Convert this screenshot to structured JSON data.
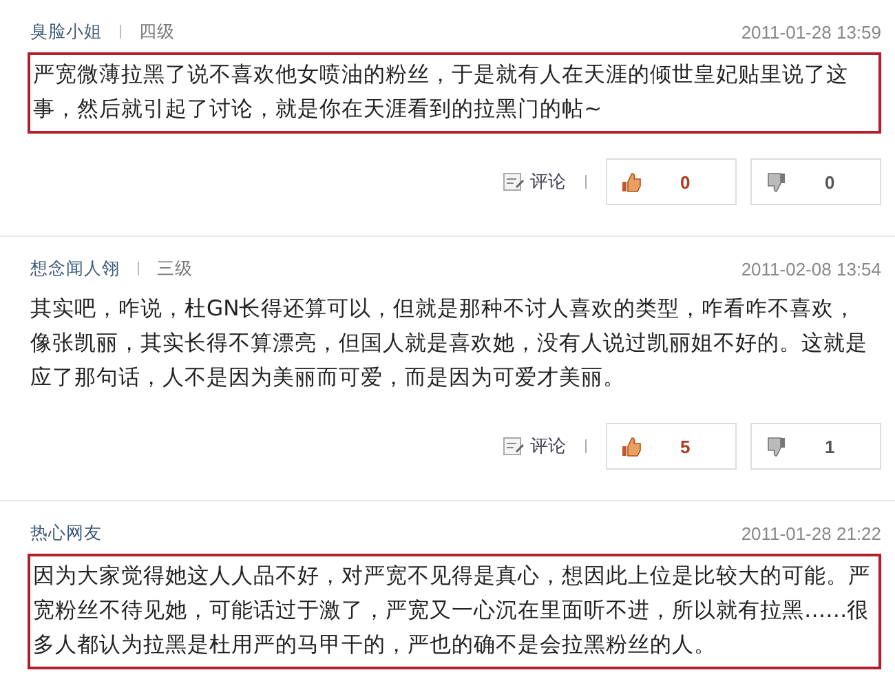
{
  "comments": [
    {
      "username": "臭脸小姐",
      "level": "四级",
      "date": "2011-01-28 13:59",
      "text": "严宽微薄拉黑了说不喜欢他女喷油的粉丝，于是就有人在天涯的倾世皇妃贴里说了这事，然后就引起了讨论，就是你在天涯看到的拉黑门的帖~",
      "highlighted": true,
      "actions": {
        "reply_label": "评论",
        "likes": "0",
        "dislikes": "0"
      }
    },
    {
      "username": "想念闻人翎",
      "level": "三级",
      "date": "2011-02-08 13:54",
      "text": "其实吧，咋说，杜GN长得还算可以，但就是那种不讨人喜欢的类型，咋看咋不喜欢，像张凯丽，其实长得不算漂亮，但国人就是喜欢她，没有人说过凯丽姐不好的。这就是应了那句话，人不是因为美丽而可爱，而是因为可爱才美丽。",
      "highlighted": false,
      "actions": {
        "reply_label": "评论",
        "likes": "5",
        "dislikes": "1"
      }
    },
    {
      "username": "热心网友",
      "date": "2011-01-28 21:22",
      "text": "因为大家觉得她这人人品不好，对严宽不见得是真心，想因此上位是比较大的可能。严宽粉丝不待见她，可能话过于激了，严宽又一心沉在里面听不进，所以就有拉黑……很多人都认为拉黑是杜用严的马甲干的，严也的确不是会拉黑粉丝的人。",
      "highlighted": true
    }
  ]
}
